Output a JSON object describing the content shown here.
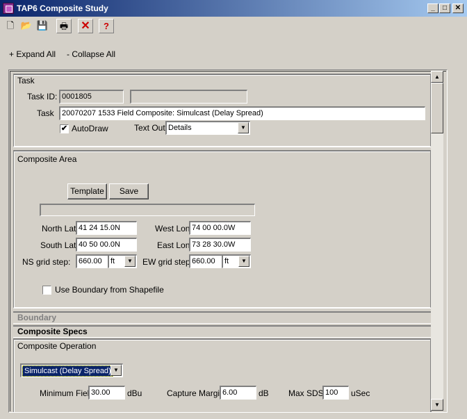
{
  "window": {
    "title": "TAP6 Composite Study",
    "minimize": "_",
    "maximize": "□",
    "close": "✕"
  },
  "toolbar": {
    "new_icon": "🗋",
    "open_icon": "📂",
    "save_icon": "💾",
    "print_icon": "🖶",
    "delete_icon": "✕",
    "help_icon": "?"
  },
  "expand": {
    "expand_all": "+ Expand All",
    "collapse_all": "- Collapse All"
  },
  "task": {
    "group_title": "Task",
    "task_id_label": "Task ID:",
    "task_id_value": "0001805",
    "task_id_extra": "",
    "task_label": "Task",
    "task_value": "20070207 1533 Field Composite: Simulcast (Delay Spread)",
    "autodraw_label": "AutoDraw",
    "autodraw_checked": "✔",
    "text_out_label": "Text Out:",
    "text_out_value": "Details"
  },
  "composite_area": {
    "group_title": "Composite Area",
    "template_button": "Template",
    "save_button": "Save",
    "north_lat_label": "North Lat",
    "north_lat_value": "41 24 15.0N",
    "west_lon_label": "West Lon",
    "west_lon_value": "74 00 00.0W",
    "south_lat_label": "South Lat",
    "south_lat_value": "40 50 00.0N",
    "east_lon_label": "East Lon",
    "east_lon_value": "73 28 30.0W",
    "ns_grid_label": "NS grid step:",
    "ns_grid_value": "660.00",
    "ns_grid_unit": "ft",
    "ew_grid_label": "EW grid step:",
    "ew_grid_value": "660.00",
    "ew_grid_unit": "ft",
    "boundary_checkbox_label": "Use Boundary from Shapefile"
  },
  "sections": {
    "boundary": "Boundary",
    "composite_specs": "Composite Specs"
  },
  "composite_operation": {
    "group_title": "Composite Operation",
    "operation_value": "Simulcast (Delay Spread)",
    "min_field_label": "Minimum Field",
    "min_field_value": "30.00",
    "min_field_unit": "dBu",
    "capture_margin_label": "Capture Margin",
    "capture_margin_value": "6.00",
    "capture_margin_unit": "dB",
    "max_sds_label": "Max SDS",
    "max_sds_value": "100",
    "max_sds_unit": "uSec"
  },
  "scrollbar": {
    "up_arrow": "▲",
    "down_arrow": "▼"
  }
}
